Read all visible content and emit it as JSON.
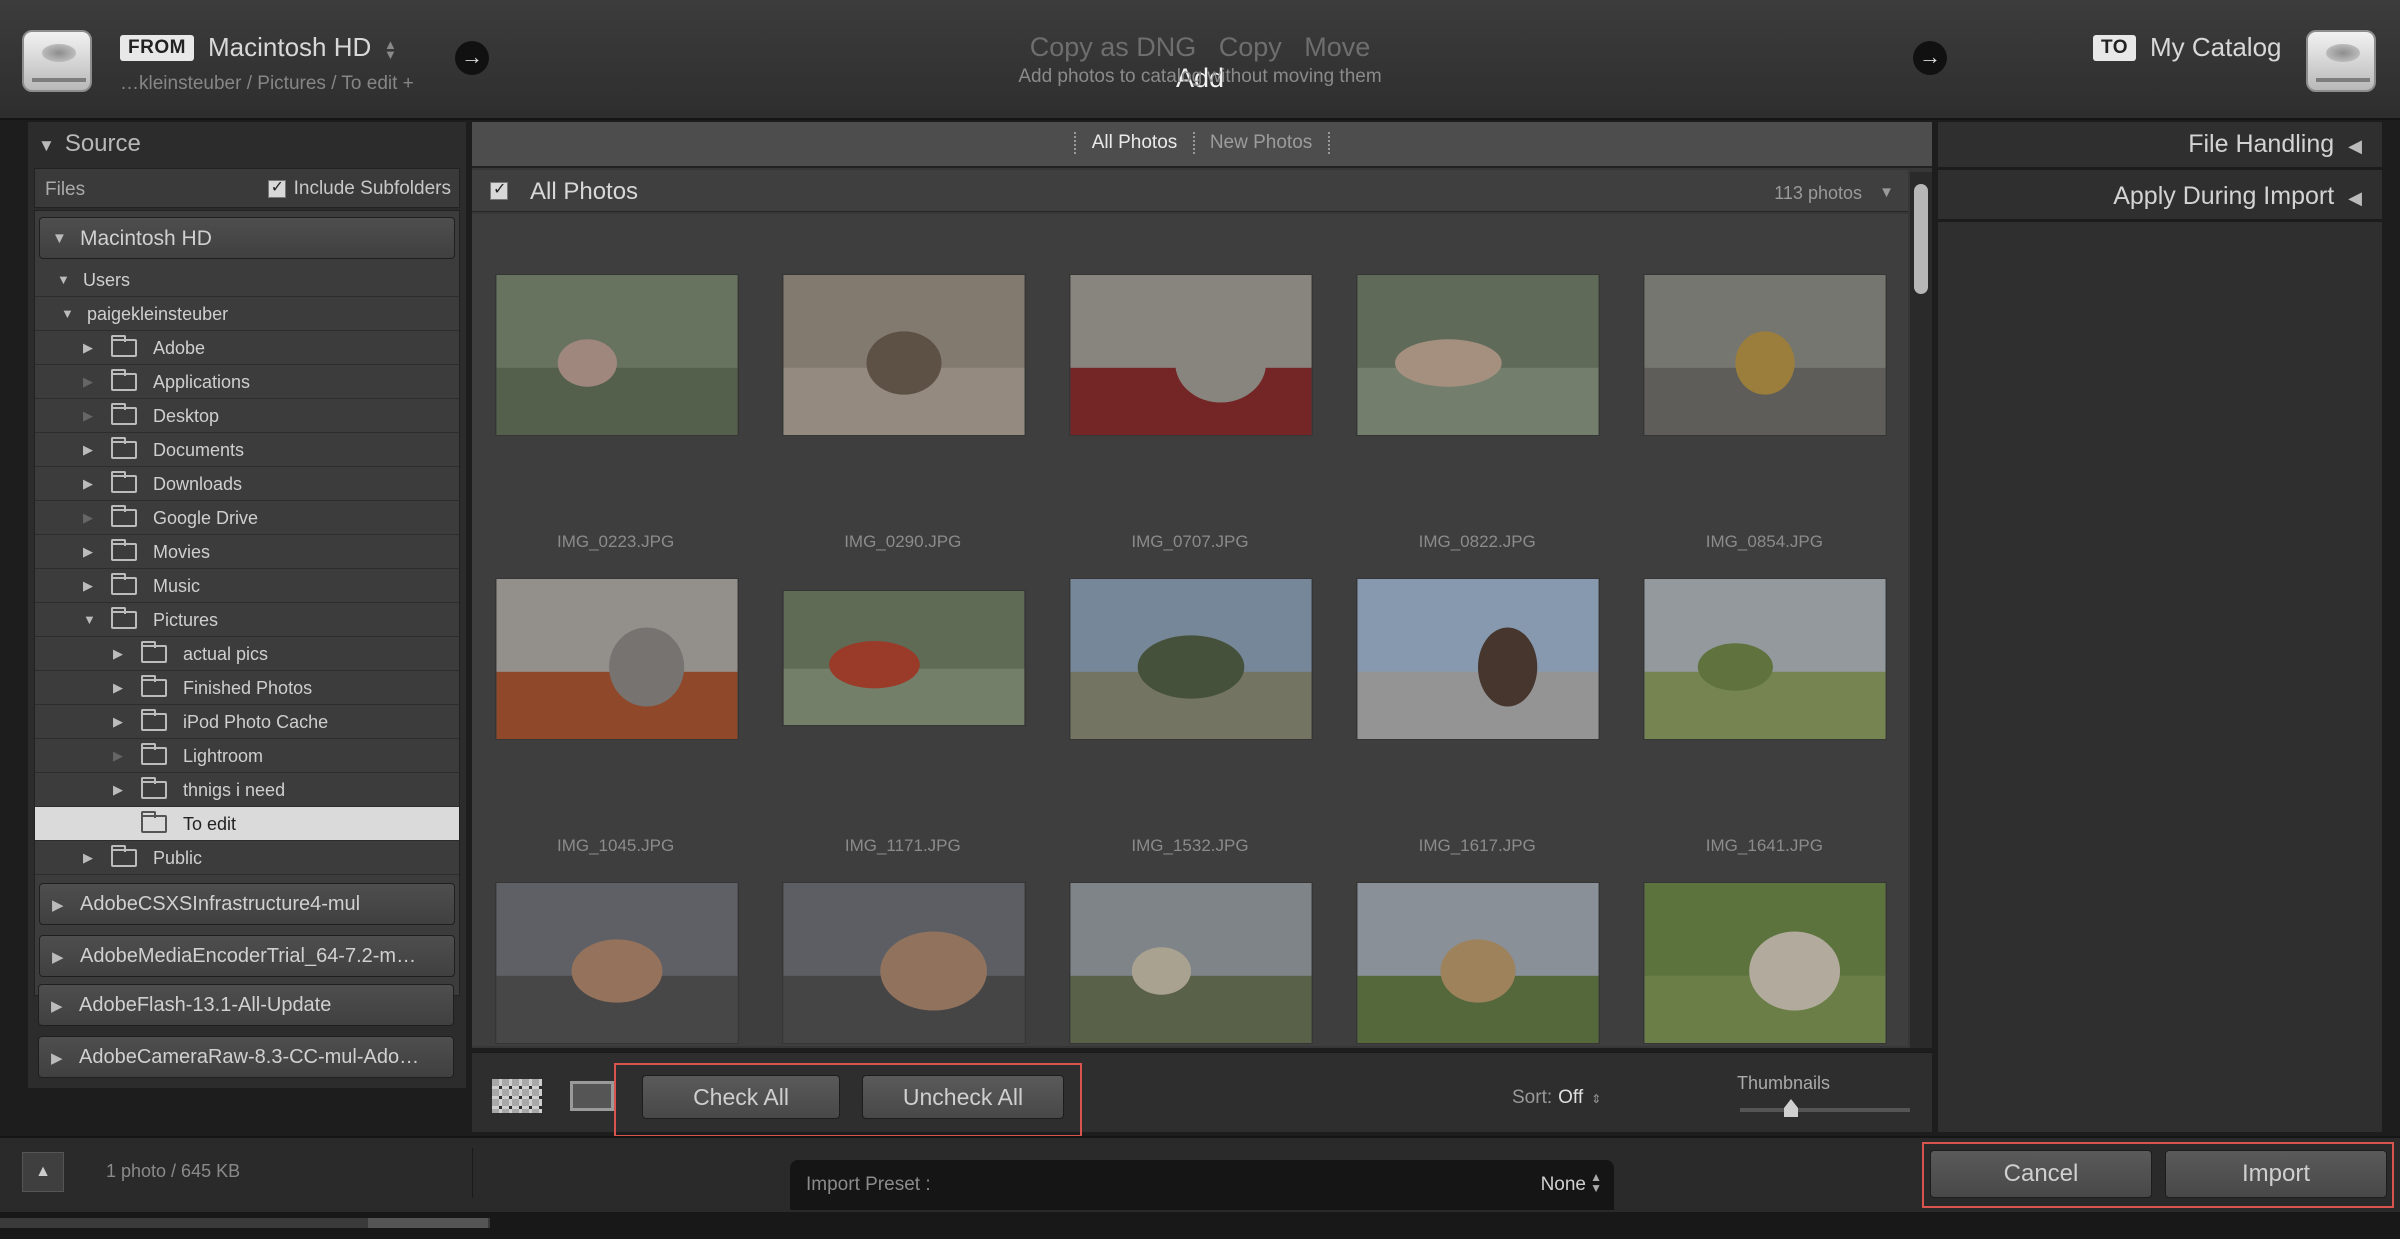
{
  "header": {
    "from_tag": "FROM",
    "from_source": "Macintosh HD",
    "from_path": "…kleinsteuber / Pictures / To edit +",
    "modes": [
      "Copy as DNG",
      "Copy",
      "Move",
      "Add"
    ],
    "active_mode": "Add",
    "mode_description": "Add photos to catalog without moving them",
    "to_tag": "TO",
    "to_destination": "My Catalog"
  },
  "source_panel": {
    "title": "Source",
    "files_label": "Files",
    "include_subfolders_label": "Include Subfolders",
    "include_subfolders_checked": true,
    "main_volume": "Macintosh HD",
    "users_label": "Users",
    "user_folder": "paigekleinsteuber",
    "folders": [
      "Adobe",
      "Applications",
      "Desktop",
      "Documents",
      "Downloads",
      "Google Drive",
      "Movies",
      "Music",
      "Pictures"
    ],
    "picture_subfolders": [
      "actual pics",
      "Finished Photos",
      "iPod Photo Cache",
      "Lightroom",
      "thnigs i need",
      "To edit"
    ],
    "selected_folder": "To edit",
    "public_folder": "Public",
    "other_volumes": [
      "AdobeCSXSInfrastructure4-mul",
      "AdobeMediaEncoderTrial_64-7.2-m…",
      "AdobeFlash-13.1-All-Update",
      "AdobeCameraRaw-8.3-CC-mul-Ado…"
    ]
  },
  "grid": {
    "tabs": [
      "All Photos",
      "New Photos"
    ],
    "active_tab": "All Photos",
    "section_title": "All Photos",
    "photo_count": "113 photos",
    "photos": [
      {
        "name": "IMG_0223.JPG",
        "subject": "girl-outdoors"
      },
      {
        "name": "IMG_0290.JPG",
        "subject": "yorkie-dog"
      },
      {
        "name": "IMG_0707.JPG",
        "subject": "soda-can"
      },
      {
        "name": "IMG_0822.JPG",
        "subject": "child-profile"
      },
      {
        "name": "IMG_0854.JPG",
        "subject": "rubber-ducks"
      },
      {
        "name": "IMG_1045.JPG",
        "subject": "ball-on-ledge"
      },
      {
        "name": "IMG_1171.JPG",
        "subject": "tomatoes"
      },
      {
        "name": "IMG_1532.JPG",
        "subject": "tree-landscape"
      },
      {
        "name": "IMG_1617.JPG",
        "subject": "horse"
      },
      {
        "name": "IMG_1641.JPG",
        "subject": "field"
      },
      {
        "name": "",
        "subject": "sunset-1"
      },
      {
        "name": "",
        "subject": "sunset-2"
      },
      {
        "name": "",
        "subject": "puppy-1"
      },
      {
        "name": "",
        "subject": "puppy-2"
      },
      {
        "name": "",
        "subject": "puppy-3"
      }
    ]
  },
  "toolbar": {
    "check_all": "Check All",
    "uncheck_all": "Uncheck All",
    "sort_label": "Sort:",
    "sort_value": "Off",
    "thumbnails_label": "Thumbnails",
    "thumbnail_size_fraction": 0.3
  },
  "right_panel": {
    "file_handling": "File Handling",
    "apply_during_import": "Apply During Import"
  },
  "footer": {
    "size_info": "1 photo / 645 KB",
    "import_preset_label": "Import Preset :",
    "import_preset_value": "None",
    "cancel": "Cancel",
    "import": "Import"
  },
  "colors": {
    "highlight": "#d9534f",
    "background": "#1d1d1d",
    "panel": "#2c2c2c"
  }
}
